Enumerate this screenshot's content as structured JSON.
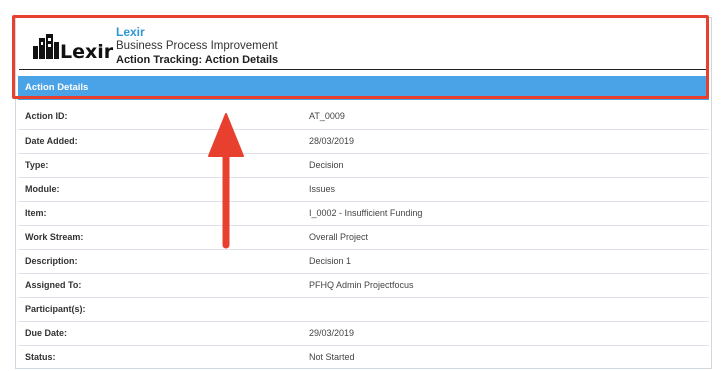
{
  "header": {
    "logo_text": "Lexir",
    "brand": "Lexir",
    "subtitle": "Business Process Improvement",
    "title": "Action Tracking: Action Details"
  },
  "section": {
    "title": "Action Details"
  },
  "fields": [
    {
      "label": "Action ID:",
      "value": "AT_0009"
    },
    {
      "label": "Date Added:",
      "value": "28/03/2019"
    },
    {
      "label": "Type:",
      "value": "Decision"
    },
    {
      "label": "Module:",
      "value": "Issues"
    },
    {
      "label": "Item:",
      "value": "I_0002 - Insufficient Funding"
    },
    {
      "label": "Work Stream:",
      "value": "Overall Project"
    },
    {
      "label": "Description:",
      "value": "Decision 1"
    },
    {
      "label": "Assigned To:",
      "value": "PFHQ Admin Projectfocus"
    },
    {
      "label": "Participant(s):",
      "value": ""
    },
    {
      "label": "Due Date:",
      "value": "29/03/2019"
    },
    {
      "label": "Status:",
      "value": "Not Started"
    }
  ],
  "colors": {
    "accent": "#2f96d6",
    "section_bar": "#4aa3e6",
    "annotation": "#e8402f"
  },
  "annotation": {
    "icon": "arrow-up-icon"
  }
}
